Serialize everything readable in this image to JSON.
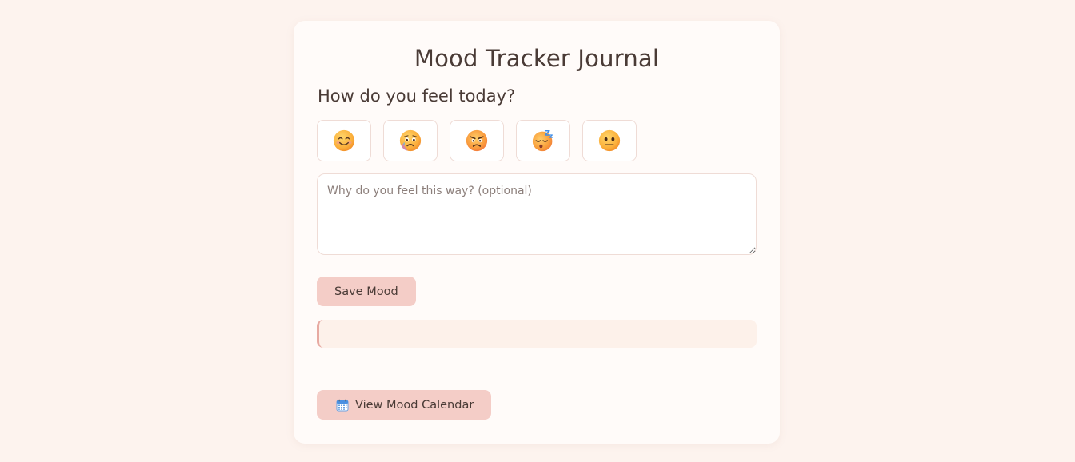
{
  "app": {
    "title": "Mood Tracker Journal"
  },
  "mood_prompt": "How do you feel today?",
  "moods": [
    {
      "icon": "smiling-face-icon",
      "emoji": "😊"
    },
    {
      "icon": "sad-face-icon",
      "emoji": "😢"
    },
    {
      "icon": "angry-face-icon",
      "emoji": "😠"
    },
    {
      "icon": "sleeping-face-icon",
      "emoji": "😴"
    },
    {
      "icon": "neutral-face-icon",
      "emoji": "😐"
    }
  ],
  "reason_input": {
    "placeholder": "Why do you feel this way? (optional)",
    "value": ""
  },
  "save_button": {
    "label": "Save Mood"
  },
  "status_message": {
    "text": ""
  },
  "calendar_button": {
    "icon": "calendar-icon",
    "label": "View Mood Calendar"
  },
  "colors": {
    "page_background": "#fdf3ee",
    "card_background": "#fffbf9",
    "button_background": "#f4cdc7",
    "message_background": "#fdf1ea",
    "message_accent": "#e7aaa2",
    "text": "#4a3b36"
  }
}
